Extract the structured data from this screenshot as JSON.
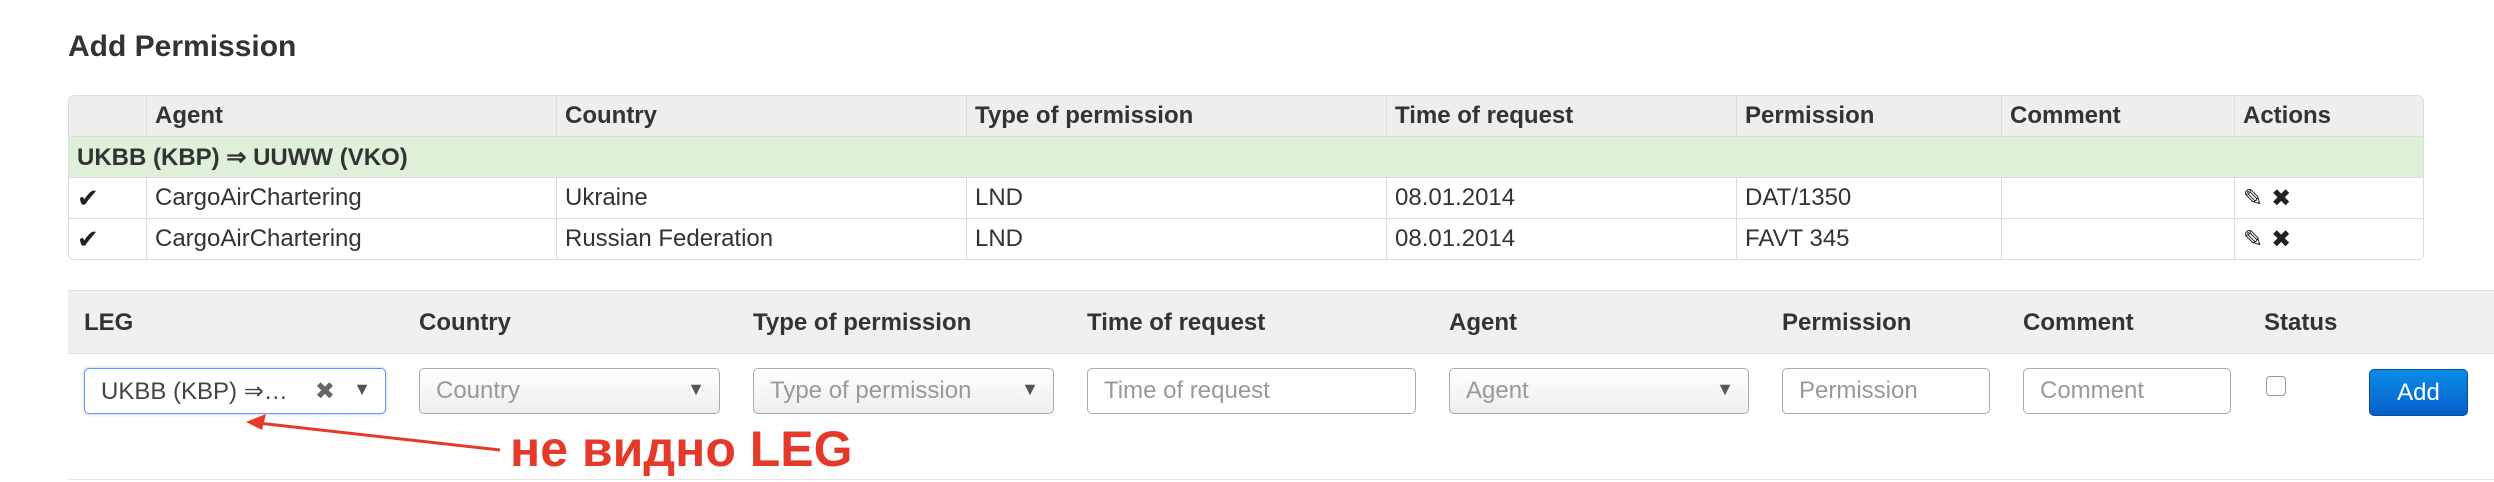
{
  "page_title": "Add Permission",
  "table": {
    "headers": [
      "",
      "Agent",
      "Country",
      "Type of permission",
      "Time of request",
      "Permission",
      "Comment",
      "Actions"
    ],
    "group_label": "UKBB (KBP) ⇒ UUWW (VKO)",
    "rows": [
      {
        "check": "✔",
        "agent": "CargoAirChartering",
        "country": "Ukraine",
        "type": "LND",
        "time": "08.01.2014",
        "permission": "DAT/1350",
        "comment": ""
      },
      {
        "check": "✔",
        "agent": "CargoAirChartering",
        "country": "Russian Federation",
        "type": "LND",
        "time": "08.01.2014",
        "permission": "FAVT 345",
        "comment": ""
      }
    ]
  },
  "form": {
    "headers": [
      "LEG",
      "Country",
      "Type of permission",
      "Time of request",
      "Agent",
      "Permission",
      "Comment",
      "Status"
    ],
    "leg_value": "UKBB (KBP) ⇒…",
    "country_placeholder": "Country",
    "type_placeholder": "Type of permission",
    "time_placeholder": "Time of request",
    "agent_placeholder": "Agent",
    "permission_placeholder": "Permission",
    "comment_placeholder": "Comment",
    "add_label": "Add",
    "status_checked": false
  },
  "annotation": "не видно LEG",
  "colors": {
    "accent": "#0a8ce8",
    "annotation": "#e53a2a",
    "group_row": "#dff0d8"
  }
}
